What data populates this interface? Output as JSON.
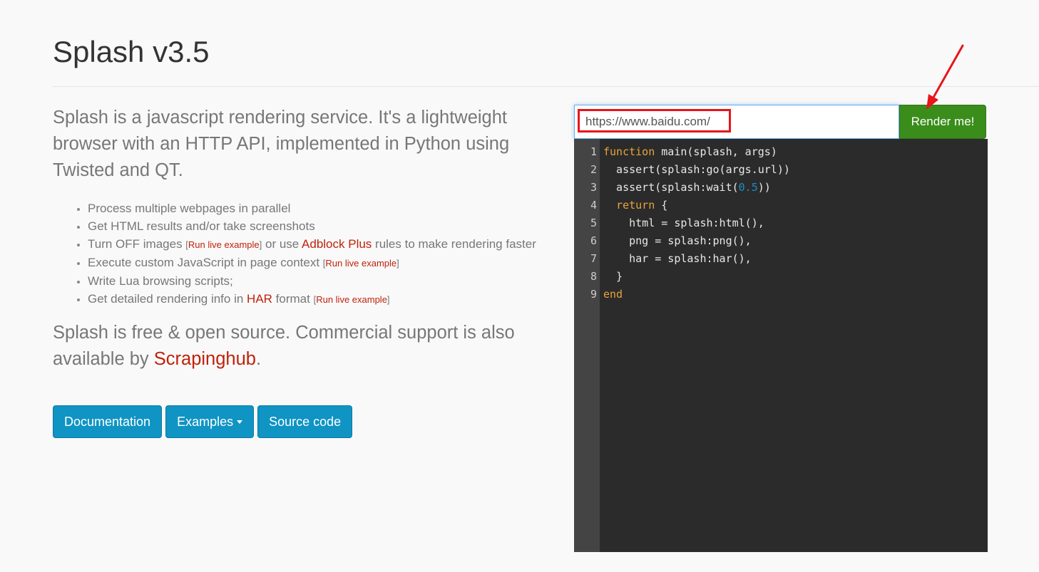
{
  "header": {
    "title": "Splash v3.5"
  },
  "intro": "Splash is a javascript rendering service. It's a lightweight browser with an HTTP API, implemented in Python using Twisted and QT.",
  "features": {
    "f1": "Process multiple webpages in parallel",
    "f2": "Get HTML results and/or take screenshots",
    "f3_a": "Turn OFF images ",
    "f3_b": " or use ",
    "f3_link": "Adblock Plus",
    "f3_c": " rules to make rendering faster",
    "f4": "Execute custom JavaScript in page context ",
    "f5": "Write Lua browsing scripts;",
    "f6_a": "Get detailed rendering info in ",
    "f6_link": "HAR",
    "f6_b": " format ",
    "live_example": "Run live example",
    "bracket_open": "[",
    "bracket_close": "]"
  },
  "support": {
    "text": "Splash is free & open source. Commercial support is also available by ",
    "link": "Scrapinghub",
    "end": "."
  },
  "buttons": {
    "documentation": "Documentation",
    "examples": "Examples",
    "source": "Source code"
  },
  "render": {
    "url_value": "https://www.baidu.com/",
    "button": "Render me!"
  },
  "editor": {
    "lines": [
      {
        "n": "1",
        "kw": "function",
        "rest": " main(splash, args)"
      },
      {
        "n": "2",
        "pre": "  assert(splash:go(args.url))"
      },
      {
        "n": "3",
        "pre": "  assert(splash:wait(",
        "num": "0.5",
        "post": "))"
      },
      {
        "n": "4",
        "indent": "  ",
        "kw": "return",
        "rest": " {"
      },
      {
        "n": "5",
        "pre": "    html = splash:html(),"
      },
      {
        "n": "6",
        "pre": "    png = splash:png(),"
      },
      {
        "n": "7",
        "pre": "    har = splash:har(),"
      },
      {
        "n": "8",
        "pre": "  }"
      },
      {
        "n": "9",
        "kw": "end"
      }
    ]
  },
  "colors": {
    "accent_blue": "#0f94c4",
    "render_green": "#3a8d1b",
    "link_red": "#c0210b",
    "annotation_red": "#e8151b"
  }
}
